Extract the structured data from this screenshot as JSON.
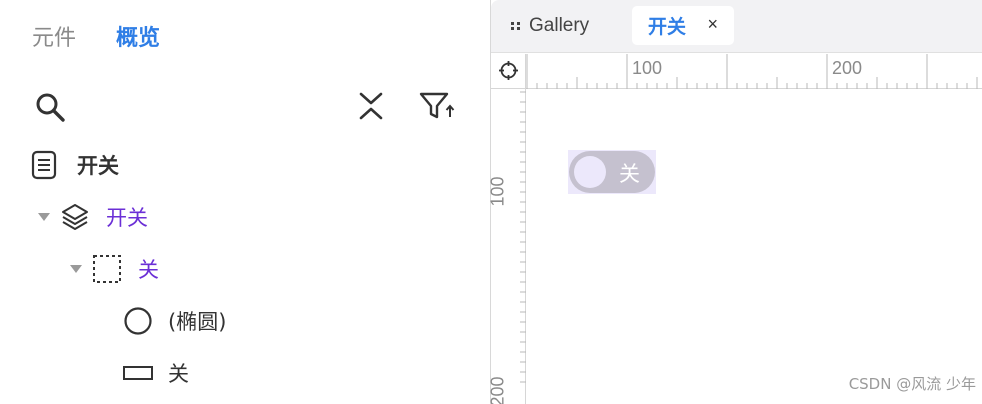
{
  "left_panel": {
    "tabs": [
      {
        "label": "元件"
      },
      {
        "label": "概览"
      }
    ],
    "toolbar": {
      "search_icon": "search-icon",
      "collapse_icon": "collapse-all-icon",
      "filter_icon": "filter-sort-icon"
    },
    "tree": [
      {
        "label": "开关",
        "icon": "page-icon"
      },
      {
        "label": "开关",
        "icon": "layers-icon"
      },
      {
        "label": "关",
        "icon": "dashed-group-icon"
      },
      {
        "label": "(椭圆)",
        "icon": "ellipse-icon"
      },
      {
        "label": "关",
        "icon": "rectangle-icon"
      }
    ]
  },
  "right_panel": {
    "tabs": [
      {
        "label": "Gallery",
        "icon": "grip-icon"
      },
      {
        "label": "开关",
        "close": "×"
      }
    ],
    "ruler": {
      "corner_icon": "crosshair-icon",
      "top_labels": [
        "100",
        "200"
      ],
      "left_labels": [
        "100",
        "200"
      ]
    },
    "canvas": {
      "switch_label": "关"
    }
  },
  "watermark": "CSDN @风流 少年",
  "colors": {
    "accent": "#2f7ee6",
    "tree_highlight": "#6b2fd6",
    "switch_track": "#c5c1cf",
    "switch_knob": "#ece8fb"
  }
}
